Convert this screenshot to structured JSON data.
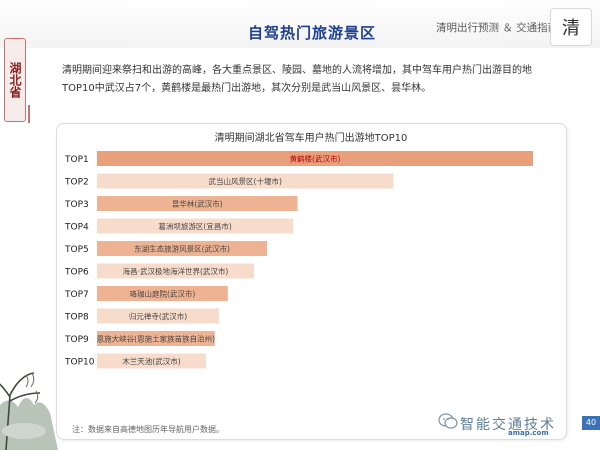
{
  "header": {
    "section_title": "自驾热门旅游景区",
    "report_title": "清明出行预测 ＆ 交通指南",
    "seal_char": "清"
  },
  "sidebar": {
    "province_tag": "湖北省"
  },
  "intro": {
    "text": "清明期间迎来祭扫和出游的高峰，各大重点景区、陵园、墓地的人流将增加，其中驾车用户热门出游目的地TOP10中武汉占7个，黄鹤楼是最热门出游地，其次分别是武当山风景区、昙华林。"
  },
  "chart_data": {
    "type": "bar",
    "orientation": "horizontal",
    "title": "清明期间湖北省驾车用户热门出游地TOP10",
    "categories": [
      "TOP1",
      "TOP2",
      "TOP3",
      "TOP4",
      "TOP5",
      "TOP6",
      "TOP7",
      "TOP8",
      "TOP9",
      "TOP10"
    ],
    "labels": [
      "黄鹤楼(武汉市)",
      "武当山风景区(十堰市)",
      "昙华林(武汉市)",
      "葛洲坝旅游区(宜昌市)",
      "东湖生态旅游风景区(武汉市)",
      "海昌·武汉极地海洋世界(武汉市)",
      "珞珈山庭院(武汉市)",
      "归元禅寺(武汉市)",
      "恩施大峡谷(恩施土家族苗族自治州)",
      "木兰天池(武汉市)"
    ],
    "values": [
      100,
      68,
      46,
      45,
      39,
      36,
      30,
      28,
      27,
      25
    ],
    "xlim": [
      0,
      100
    ],
    "highlight_index": 0,
    "colors": {
      "highlight": "#e9a07a",
      "strong": "#eeb392",
      "light": "#f7dccb",
      "highlight_label": "#b30000",
      "label": "#444444",
      "category": "#222222"
    }
  },
  "footer": {
    "note": "注：数据来自高德地图历年导航用户数据。",
    "watermark": "智能交通技术",
    "brand": "amap.com",
    "page": "40"
  }
}
